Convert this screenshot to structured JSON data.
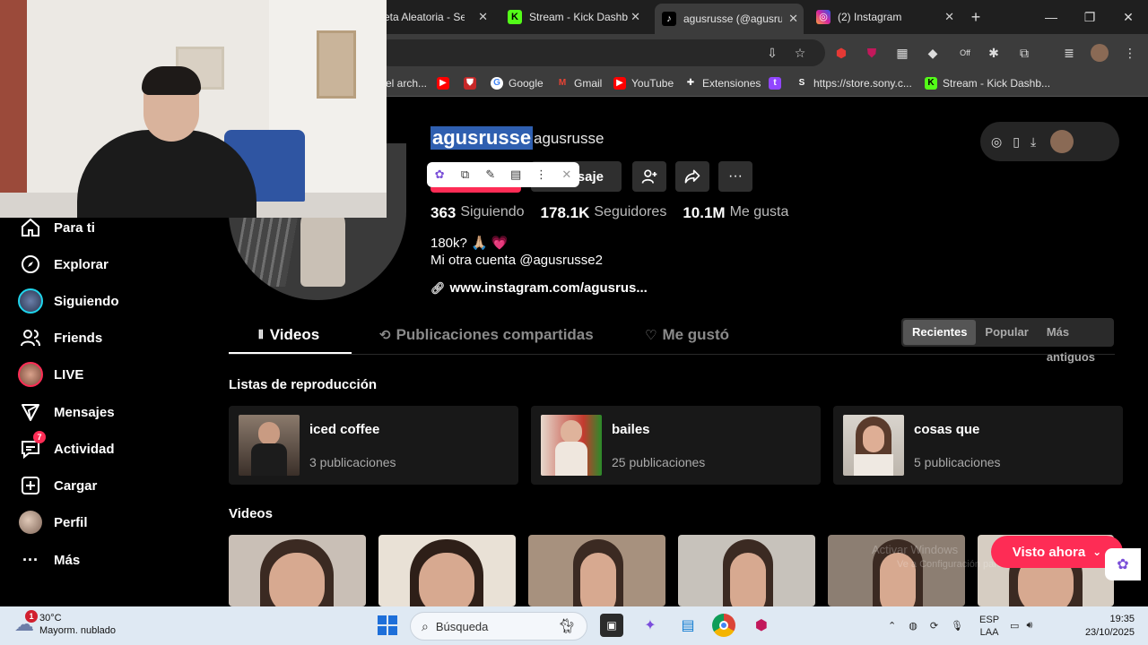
{
  "browser": {
    "tabs": [
      {
        "title": "eta Aleatoria - Sel",
        "favicon": "generic"
      },
      {
        "title": "Stream - Kick Dashbo",
        "favicon": "kick-icon"
      },
      {
        "title": "agusrusse (@agusru",
        "favicon": "tiktok-icon",
        "active": true
      },
      {
        "title": "(2) Instagram",
        "favicon": "instagram-icon"
      }
    ],
    "new_tab": "+",
    "bookmarks": [
      {
        "label": "el arch...",
        "icon": "folder-icon"
      },
      {
        "label": "",
        "icon": "youtube-icon"
      },
      {
        "label": "",
        "icon": "shield-icon"
      },
      {
        "label": "Google",
        "icon": "google-icon"
      },
      {
        "label": "Gmail",
        "icon": "gmail-icon"
      },
      {
        "label": "YouTube",
        "icon": "youtube-icon"
      },
      {
        "label": "Extensiones",
        "icon": "puzzle-icon"
      },
      {
        "label": "",
        "icon": "twitch-icon"
      },
      {
        "label": "https://store.sony.c...",
        "icon": "sony-icon"
      },
      {
        "label": "Stream - Kick Dashb...",
        "icon": "kick-icon"
      }
    ]
  },
  "sidebar": {
    "items": [
      {
        "label": "Para ti",
        "icon": "home-icon"
      },
      {
        "label": "Explorar",
        "icon": "compass-icon"
      },
      {
        "label": "Siguiendo",
        "icon": "following-avatar-icon"
      },
      {
        "label": "Friends",
        "icon": "friends-icon"
      },
      {
        "label": "LIVE",
        "icon": "live-avatar-icon"
      },
      {
        "label": "Mensajes",
        "icon": "send-icon"
      },
      {
        "label": "Actividad",
        "icon": "inbox-icon",
        "badge": "7"
      },
      {
        "label": "Cargar",
        "icon": "plus-square-icon"
      },
      {
        "label": "Perfil",
        "icon": "profile-avatar-icon"
      },
      {
        "label": "Más",
        "icon": "more-dots-icon"
      }
    ]
  },
  "profile": {
    "username": "agusrusse",
    "nickname": "agusrusse",
    "message_button": "saje",
    "stats": {
      "following": {
        "value": "363",
        "label": "Siguiendo"
      },
      "followers": {
        "value": "178.1K",
        "label": "Seguidores"
      },
      "likes": {
        "value": "10.1M",
        "label": "Me gusta"
      }
    },
    "bio_line1": "180k? 🙏🏼 💗",
    "bio_line2": "Mi otra cuenta @agusrusse2",
    "link": "www.instagram.com/agusrus..."
  },
  "tabs": {
    "videos": "Videos",
    "reposts": "Publicaciones compartidas",
    "liked": "Me gustó"
  },
  "sort": {
    "recent": "Recientes",
    "popular": "Popular",
    "oldest": "Más antiguos"
  },
  "playlists": {
    "section_title": "Listas de reproducción",
    "items": [
      {
        "title": "iced coffee",
        "count": "3 publicaciones"
      },
      {
        "title": "bailes",
        "count": "25 publicaciones"
      },
      {
        "title": "cosas que",
        "count": "5 publicaciones"
      }
    ]
  },
  "videos": {
    "section_title": "Videos"
  },
  "visto_ahora": "Visto ahora",
  "watermark": {
    "line1": "Activar Windows",
    "line2": "Ve a Configuración para activar Windows."
  },
  "taskbar": {
    "weather_temp": "30°C",
    "weather_desc": "Mayorm. nublado",
    "weather_badge": "1",
    "search_placeholder": "Búsqueda",
    "lang": "ESP",
    "lang2": "LAA",
    "time": "19:35",
    "date": "23/10/2025"
  },
  "colors": {
    "accent": "#fe2c55",
    "selection": "#2f5fb0",
    "background": "#000000"
  }
}
